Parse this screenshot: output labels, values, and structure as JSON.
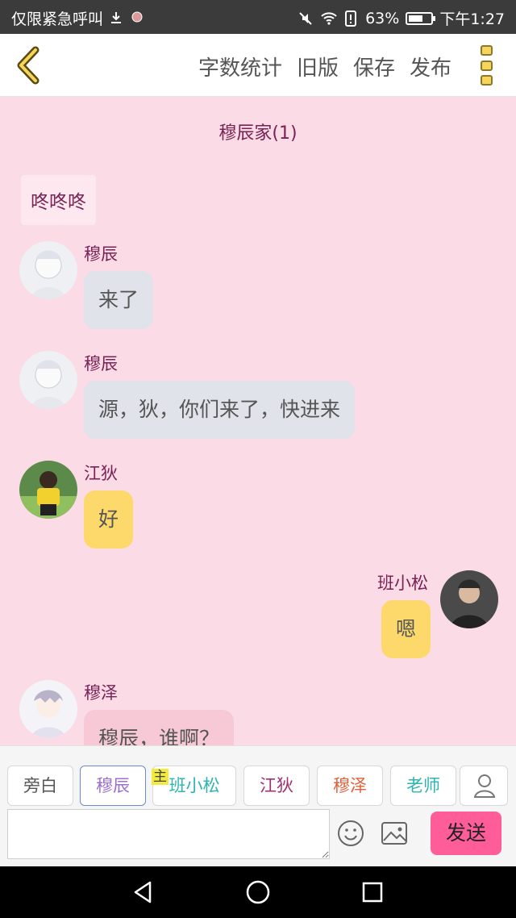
{
  "status_bar": {
    "left_text": "仅限紧急呼叫",
    "battery_text": "63%",
    "battery_level": 0.63,
    "time": "下午1:27",
    "icons": [
      "download-icon",
      "app-notification-icon",
      "mute-icon",
      "wifi-icon",
      "alert-icon",
      "battery-icon"
    ]
  },
  "toolbar": {
    "actions": [
      "字数统计",
      "旧版",
      "保存",
      "发布"
    ],
    "back_icon": "chevron-left-icon",
    "menu_icon": "more-vertical-icon",
    "accent_color": "#f6d55c"
  },
  "chat": {
    "title": "穆辰家(1)",
    "narration": "咚咚咚",
    "messages": [
      {
        "sender": "穆辰",
        "text": "来了",
        "side": "left",
        "style": "grey"
      },
      {
        "sender": "穆辰",
        "text": "源，狄，你们来了，快进来",
        "side": "left",
        "style": "grey"
      },
      {
        "sender": "江狄",
        "text": "好",
        "side": "left",
        "style": "yellow"
      },
      {
        "sender": "班小松",
        "text": "嗯",
        "side": "right",
        "style": "yellow"
      },
      {
        "sender": "穆泽",
        "text": "穆辰，谁啊？",
        "side": "left",
        "style": "pink"
      }
    ]
  },
  "roles": {
    "items": [
      {
        "label": "旁白",
        "color": "#555555"
      },
      {
        "label": "穆辰",
        "color": "#9b6fd0",
        "active": true
      },
      {
        "label": "班小松",
        "color": "#2cb5b0"
      },
      {
        "label": "江狄",
        "color": "#a0306e"
      },
      {
        "label": "穆泽",
        "color": "#e0603c"
      },
      {
        "label": "老师",
        "color": "#2cb5b0"
      }
    ],
    "host_badge": "主"
  },
  "input": {
    "value": "",
    "send_label": "发送",
    "send_color": "#ff5c9a"
  },
  "navbar": {
    "icons": [
      "back-triangle-icon",
      "home-circle-icon",
      "recents-square-icon"
    ]
  }
}
